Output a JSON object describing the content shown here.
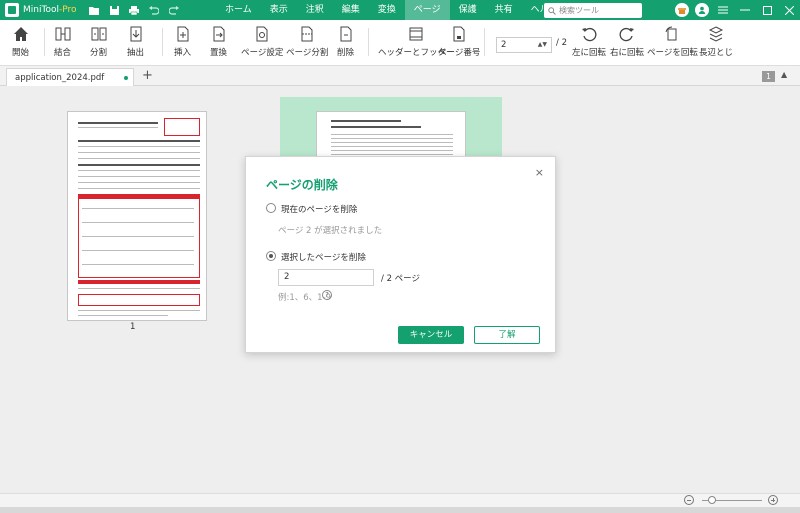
{
  "titlebar": {
    "app_name": "MiniTool",
    "app_suffix": "-Pro",
    "menu": [
      {
        "label": "ホーム"
      },
      {
        "label": "表示"
      },
      {
        "label": "注釈"
      },
      {
        "label": "編集"
      },
      {
        "label": "変換"
      },
      {
        "label": "ページ",
        "active": true
      },
      {
        "label": "保護"
      },
      {
        "label": "共有"
      },
      {
        "label": "ヘルプ"
      }
    ],
    "search_placeholder": "検索ツール"
  },
  "ribbon": {
    "open": "開始",
    "merge": "結合",
    "split": "分割",
    "extract": "抽出",
    "insert": "挿入",
    "replace": "置換",
    "page_settings": "ページ設定",
    "page_split": "ページ分割",
    "delete": "削除",
    "header_footer": "ヘッダーとフッター",
    "page_number": "ページ番号",
    "current_page": "2",
    "total_pages": "/ 2",
    "rotate_left": "左に回転",
    "rotate_right": "右に回転",
    "rotate_page": "ページを回転",
    "long_edge": "長辺とじ"
  },
  "tabs": {
    "doc_name": "application_2024.pdf",
    "add": "+",
    "page_count": "1"
  },
  "workarea": {
    "thumb1_label": "1"
  },
  "dialog": {
    "title": "ページの削除",
    "close": "×",
    "option_current": "現在のページを削除",
    "current_hint": "ページ 2 が選択されました",
    "option_selected": "選択したページを削除",
    "pages_value": "2",
    "pages_total": "/ 2 ページ",
    "example": "例:1、6、1-9",
    "help": "?",
    "cancel": "キャンセル",
    "ok": "了解"
  },
  "colors": {
    "accent": "#14a06f",
    "selection": "#b9e7cd"
  }
}
